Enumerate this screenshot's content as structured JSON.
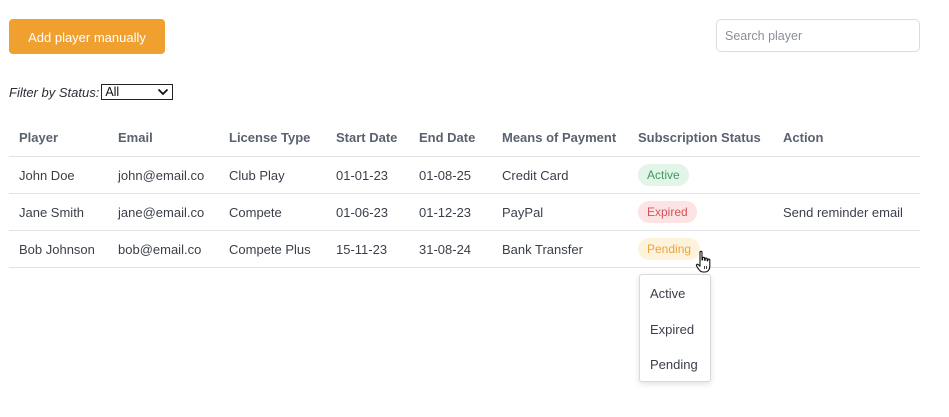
{
  "toolbar": {
    "add_button_label": "Add player manually",
    "search_placeholder": "Search player",
    "accent_color": "#f0a02f"
  },
  "filter": {
    "label": "Filter by Status:",
    "selected_value": "All"
  },
  "table": {
    "columns": [
      "Player",
      "Email",
      "License Type",
      "Start Date",
      "End Date",
      "Means of Payment",
      "Subscription Status",
      "Action"
    ],
    "rows": [
      {
        "player": "John Doe",
        "email": "john@email.co",
        "license_type": "Club Play",
        "start_date": "01-01-23",
        "end_date": "01-08-25",
        "payment": "Credit Card",
        "status": "Active",
        "action": ""
      },
      {
        "player": "Jane Smith",
        "email": "jane@email.co",
        "license_type": "Compete",
        "start_date": "01-06-23",
        "end_date": "01-12-23",
        "payment": "PayPal",
        "status": "Expired",
        "action": "Send reminder email"
      },
      {
        "player": "Bob Johnson",
        "email": "bob@email.co",
        "license_type": "Compete Plus",
        "start_date": "15-11-23",
        "end_date": "31-08-24",
        "payment": "Bank Transfer",
        "status": "Pending",
        "action": ""
      }
    ]
  },
  "status_colors": {
    "Active": {
      "bg": "#e3f5e8",
      "fg": "#3e9a5e"
    },
    "Expired": {
      "bg": "#fde3e4",
      "fg": "#d2545c"
    },
    "Pending": {
      "bg": "#fdf3dc",
      "fg": "#eea23a"
    }
  },
  "status_dropdown": {
    "options": [
      "Active",
      "Expired",
      "Pending"
    ]
  },
  "cursor": {
    "icon": "hand-pointer-icon"
  }
}
